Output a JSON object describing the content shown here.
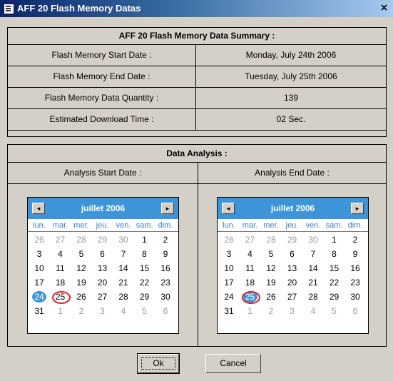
{
  "window": {
    "title": "AFF 20 Flash Memory Datas",
    "close_glyph": "×"
  },
  "summary": {
    "header": "AFF 20 Flash Memory Data Summary :",
    "rows": [
      {
        "label": "Flash Memory Start Date :",
        "value": "Monday, July 24th 2006"
      },
      {
        "label": "Flash Memory End Date :",
        "value": "Tuesday, July 25th 2006"
      },
      {
        "label": "Flash Memory Data Quantity :",
        "value": "139"
      },
      {
        "label": "Estimated Download Time :",
        "value": "02 Sec."
      }
    ]
  },
  "analysis": {
    "header": "Data Analysis :",
    "start_label": "Analysis Start Date :",
    "end_label": "Analysis End Date :"
  },
  "calendar": {
    "month_label": "juillet 2006",
    "prev_glyph": "◂",
    "next_glyph": "▸",
    "weekdays": [
      "lun.",
      "mar.",
      "mer.",
      "jeu.",
      "ven.",
      "sam.",
      "dim."
    ],
    "weeks": [
      [
        "26",
        "27",
        "28",
        "29",
        "30",
        "1",
        "2"
      ],
      [
        "3",
        "4",
        "5",
        "6",
        "7",
        "8",
        "9"
      ],
      [
        "10",
        "11",
        "12",
        "13",
        "14",
        "15",
        "16"
      ],
      [
        "17",
        "18",
        "19",
        "20",
        "21",
        "22",
        "23"
      ],
      [
        "24",
        "25",
        "26",
        "27",
        "28",
        "29",
        "30"
      ],
      [
        "31",
        "1",
        "2",
        "3",
        "4",
        "5",
        "6"
      ]
    ],
    "other_month": [
      [
        0,
        0
      ],
      [
        0,
        1
      ],
      [
        0,
        2
      ],
      [
        0,
        3
      ],
      [
        0,
        4
      ],
      [
        5,
        1
      ],
      [
        5,
        2
      ],
      [
        5,
        3
      ],
      [
        5,
        4
      ],
      [
        5,
        5
      ],
      [
        5,
        6
      ]
    ],
    "today": [
      4,
      1
    ]
  },
  "start_calendar": {
    "selected": [
      4,
      0
    ]
  },
  "end_calendar": {
    "selected": [
      4,
      1
    ]
  },
  "buttons": {
    "ok": "Ok",
    "cancel": "Cancel"
  },
  "colors": {
    "accent": "#3d95d7",
    "today_ring": "#e02020"
  }
}
